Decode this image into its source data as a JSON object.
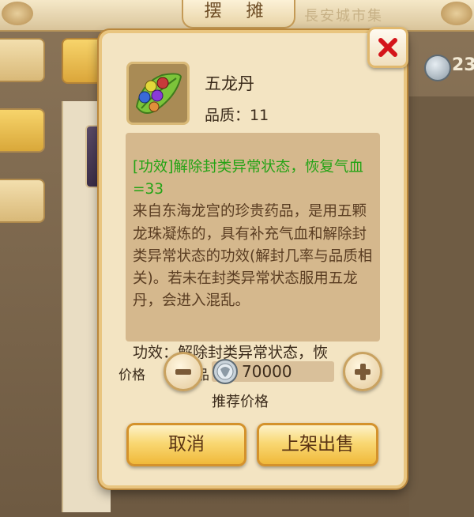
{
  "background": {
    "title": "摆 摊",
    "scroll_text": "長安城市集",
    "currency_amount": "23",
    "currency_icon": "silver-coin-icon"
  },
  "dialog": {
    "close_icon": "close-x-icon",
    "item": {
      "icon": "five-dragon-pill-icon",
      "name": "五龙丹",
      "quality": "品质：11"
    },
    "description": {
      "effect": "[功效]解除封类异常状态，恢复气血=33",
      "lore": "来自东海龙宫的珍贵药品，是用五颗龙珠凝炼的，具有补充气血和解除封类异常状态的功效(解封几率与品质相关)。若未在封类异常状态服用五龙丹，会进入混乱。"
    },
    "effect_summary": "功效：解除封类异常状态，恢",
    "price": {
      "label": "价格",
      "hidden_label": "品",
      "value": "70000",
      "coin_icon": "silver-coin-icon",
      "recommend_label": "推荐价格"
    },
    "buttons": {
      "minus": "minus-icon",
      "plus": "plus-icon",
      "cancel": "取消",
      "sell": "上架出售"
    }
  },
  "colors": {
    "effect_text": "#23a315",
    "lore_text": "#5a3d22",
    "dialog_bg": "#f3e4c2",
    "button_gold": "#f9d874"
  }
}
